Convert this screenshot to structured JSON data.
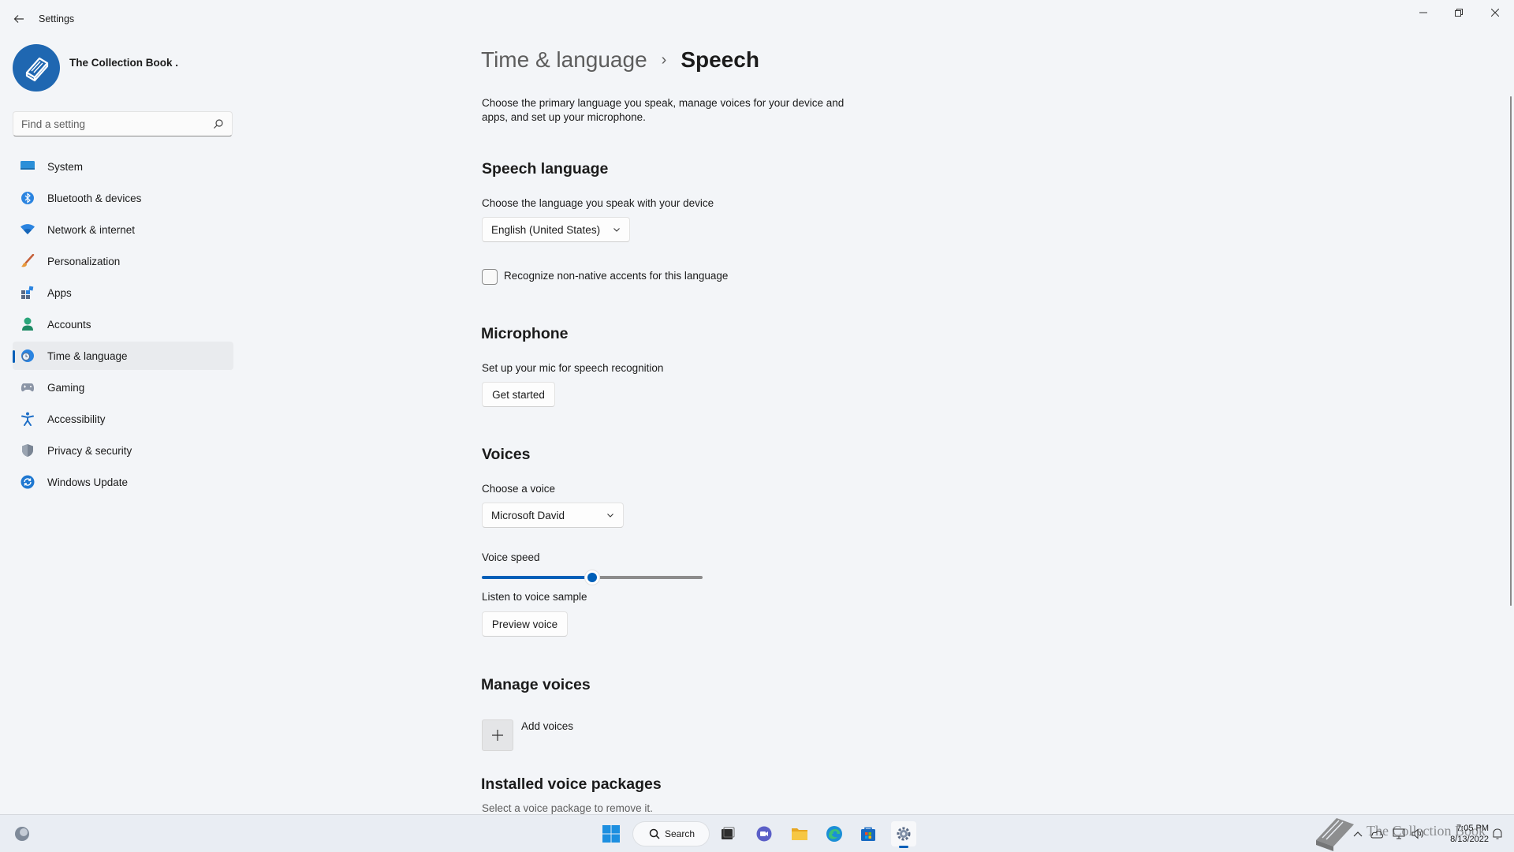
{
  "window": {
    "title": "Settings",
    "back_label": "Back",
    "minimize": "Minimize",
    "maximize": "Restore",
    "close": "Close"
  },
  "profile": {
    "name": "The Collection Book ."
  },
  "search": {
    "placeholder": "Find a setting"
  },
  "nav": {
    "items": [
      {
        "label": "System",
        "icon": "system-icon"
      },
      {
        "label": "Bluetooth & devices",
        "icon": "bluetooth-icon"
      },
      {
        "label": "Network & internet",
        "icon": "wifi-icon"
      },
      {
        "label": "Personalization",
        "icon": "brush-icon"
      },
      {
        "label": "Apps",
        "icon": "apps-icon"
      },
      {
        "label": "Accounts",
        "icon": "person-icon"
      },
      {
        "label": "Time & language",
        "icon": "globe-clock-icon",
        "selected": true
      },
      {
        "label": "Gaming",
        "icon": "gamepad-icon"
      },
      {
        "label": "Accessibility",
        "icon": "accessibility-icon"
      },
      {
        "label": "Privacy & security",
        "icon": "shield-icon"
      },
      {
        "label": "Windows Update",
        "icon": "update-icon"
      }
    ]
  },
  "breadcrumb": {
    "parent": "Time & language",
    "separator": "›",
    "current": "Speech"
  },
  "intro": "Choose the primary language you speak, manage voices for your device and apps, and set up your microphone.",
  "speech_language": {
    "heading": "Speech language",
    "label": "Choose the language you speak with your device",
    "selected": "English (United States)",
    "checkbox_label": "Recognize non-native accents for this language",
    "checkbox_checked": false
  },
  "microphone": {
    "heading": "Microphone",
    "label": "Set up your mic for speech recognition",
    "button": "Get started"
  },
  "voices": {
    "heading": "Voices",
    "choose_label": "Choose a voice",
    "selected": "Microsoft David",
    "speed_label": "Voice speed",
    "speed_value": 0.5,
    "sample_label": "Listen to voice sample",
    "preview_button": "Preview voice"
  },
  "manage_voices": {
    "heading": "Manage voices",
    "add_label": "Add voices"
  },
  "installed": {
    "heading": "Installed voice packages",
    "label": "Select a voice package to remove it."
  },
  "taskbar": {
    "search_label": "Search",
    "time": "7:05 PM",
    "date": "8/13/2022",
    "watermark": "The Collection Book"
  },
  "colors": {
    "accent": "#005fb8",
    "background": "#f3f5f8",
    "avatar": "#1f67b1"
  }
}
